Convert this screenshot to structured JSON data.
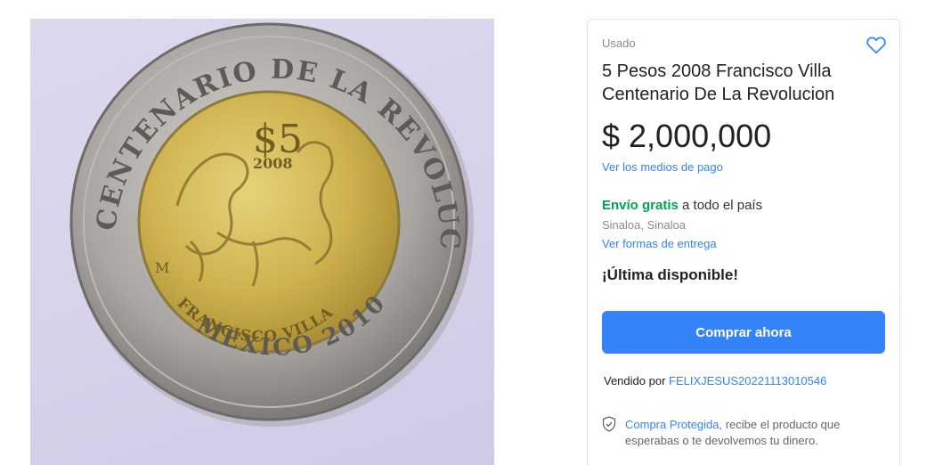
{
  "image": {
    "alt": "coin-photo"
  },
  "coin": {
    "outer_ring_text": "CENTENARIO DE LA REVOLUCION",
    "bottom_ring_text": "MEXICO 2010",
    "denomination": "$5",
    "year": "2008",
    "name": "FRANCISCO VILLA",
    "mint_mark": "M"
  },
  "product": {
    "condition": "Usado",
    "title": "5 Pesos 2008 Francisco Villa Centenario De La Revolucion",
    "price": "$ 2,000,000",
    "payment_link": "Ver los medios de pago"
  },
  "shipping": {
    "free_label": "Envío gratis",
    "scope": " a todo el país",
    "location": "Sinaloa, Sinaloa",
    "delivery_link": "Ver formas de entrega"
  },
  "stock": {
    "label": "¡Última disponible!"
  },
  "actions": {
    "buy_now": "Comprar ahora"
  },
  "seller": {
    "prefix": "Vendido por",
    "name": "FELIXJESUS20221113010546"
  },
  "protection": {
    "link": "Compra Protegida",
    "text": ", recibe el producto que esperabas o te devolvemos tu dinero."
  },
  "colors": {
    "accent": "#3483fa",
    "free_shipping": "#00a650"
  }
}
